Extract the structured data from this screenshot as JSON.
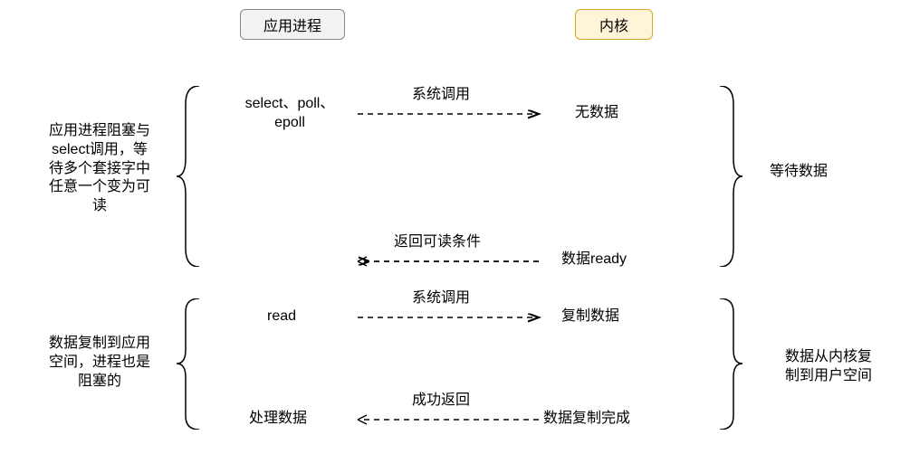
{
  "header": {
    "app_process": "应用进程",
    "kernel": "内核"
  },
  "left": {
    "block1": "应用进程阻塞与\nselect调用，等\n待多个套接字中\n任意一个变为可\n读",
    "block2": "数据复制到应用\n空间，进程也是\n阻塞的"
  },
  "right": {
    "label1": "等待数据",
    "label2": "数据从内核复\n制到用户空间"
  },
  "col_left": {
    "l1": "select、poll、\nepoll",
    "l2": "read",
    "l3": "处理数据"
  },
  "col_right": {
    "r1": "无数据",
    "r2": "数据ready",
    "r3": "复制数据",
    "r4": "数据复制完成"
  },
  "arrows": {
    "a1": "系统调用",
    "a2": "返回可读条件",
    "a3": "系统调用",
    "a4": "成功返回"
  },
  "chart_data": {
    "type": "sequence-diagram",
    "actors": [
      "应用进程",
      "内核"
    ],
    "left_descriptions": [
      "应用进程阻塞与select调用，等待多个套接字中任意一个变为可读",
      "数据复制到应用空间，进程也是阻塞的"
    ],
    "right_phases": [
      "等待数据",
      "数据从内核复制到用户空间"
    ],
    "steps": [
      {
        "from": "应用进程",
        "from_state": "select、poll、epoll",
        "to": "内核",
        "to_state": "无数据",
        "label": "系统调用",
        "direction": "right"
      },
      {
        "from": "内核",
        "from_state": "数据ready",
        "to": "应用进程",
        "to_state": "",
        "label": "返回可读条件",
        "direction": "left"
      },
      {
        "from": "应用进程",
        "from_state": "read",
        "to": "内核",
        "to_state": "复制数据",
        "label": "系统调用",
        "direction": "right"
      },
      {
        "from": "内核",
        "from_state": "数据复制完成",
        "to": "应用进程",
        "to_state": "处理数据",
        "label": "成功返回",
        "direction": "left"
      }
    ]
  }
}
